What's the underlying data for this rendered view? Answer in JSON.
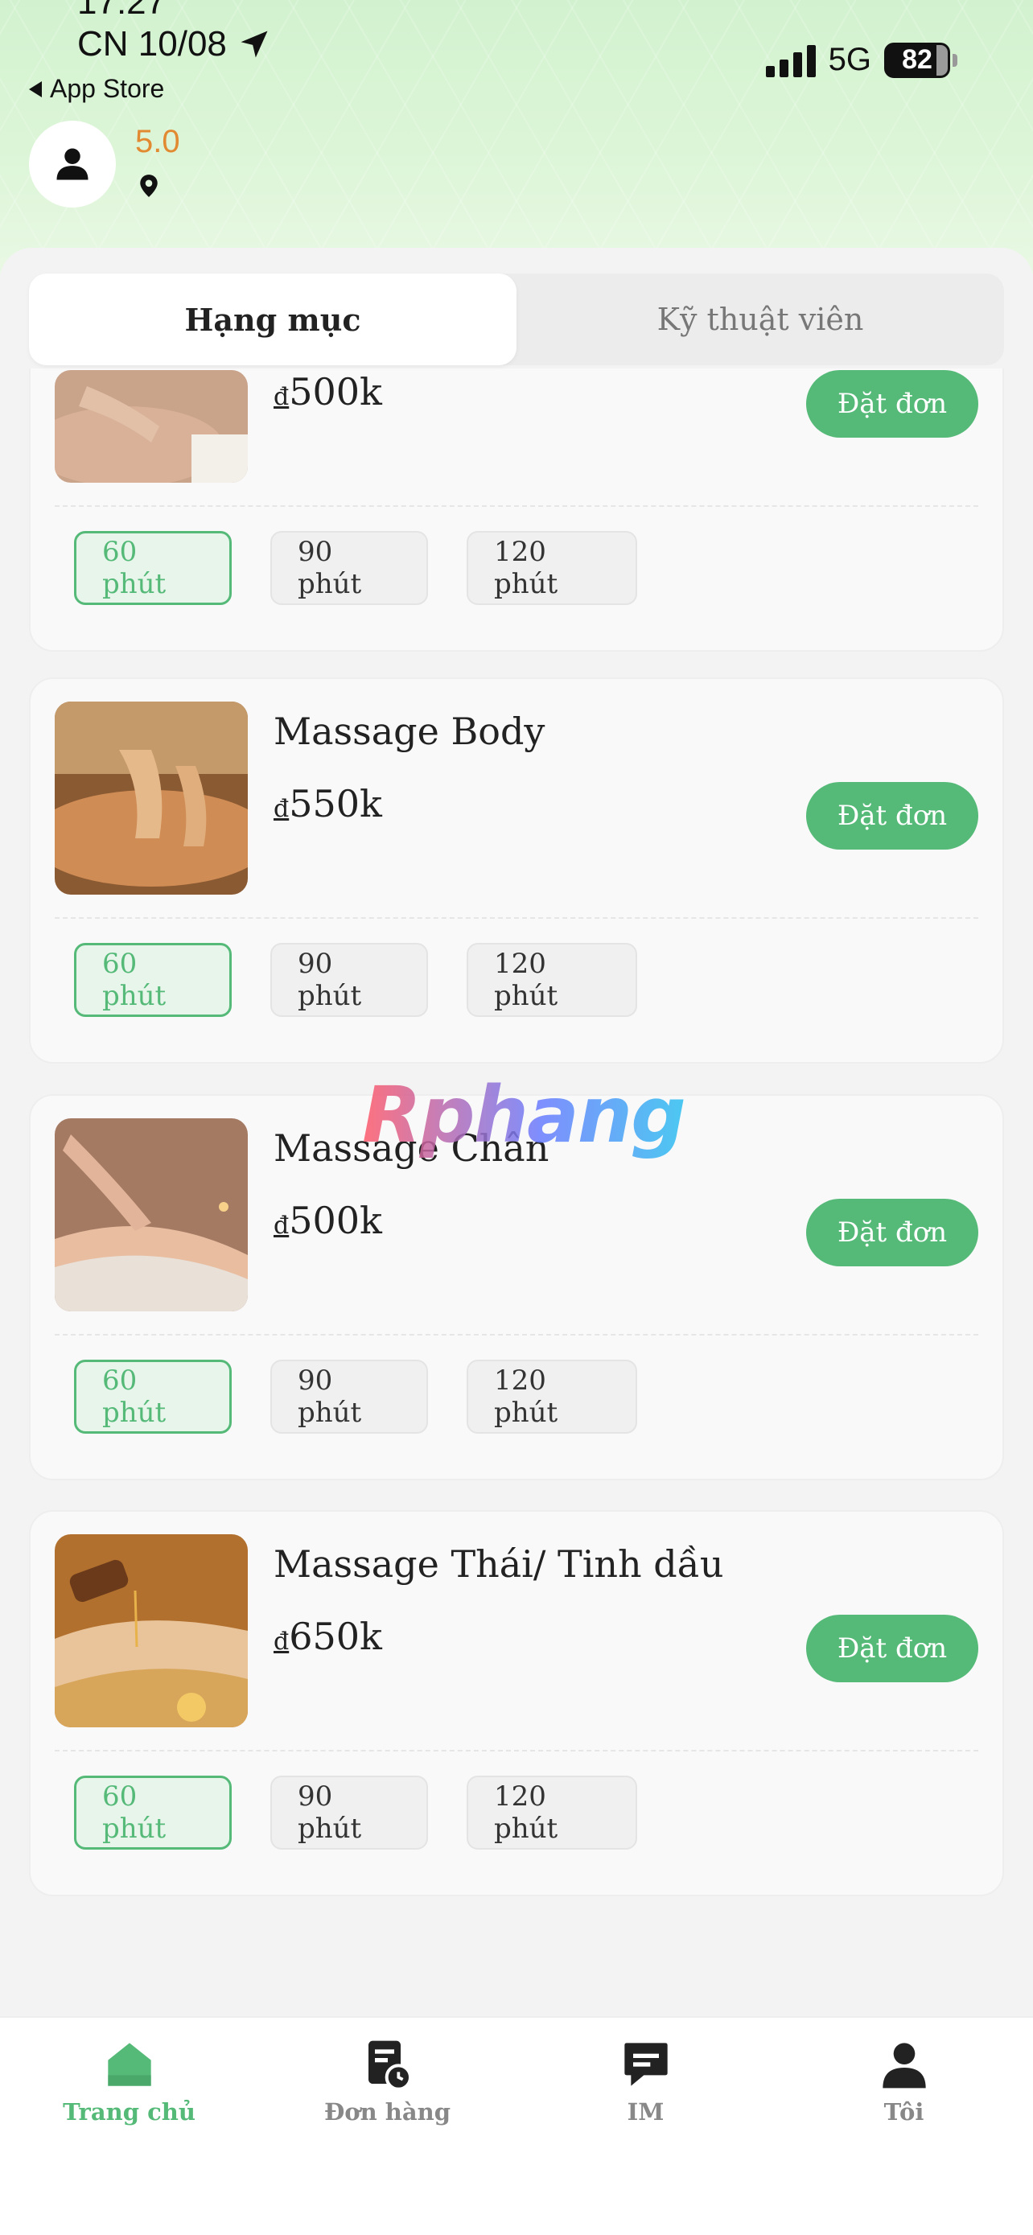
{
  "status_bar": {
    "time": "17:27",
    "date": "CN 10/08",
    "back_app": "App Store",
    "network": "5G",
    "battery": "82"
  },
  "profile": {
    "rating": "5.0"
  },
  "tabs": [
    {
      "label": "Hạng mục",
      "active": true
    },
    {
      "label": "Kỹ thuật viên",
      "active": false
    }
  ],
  "services": [
    {
      "name": "",
      "currency": "đ",
      "price": "500k",
      "book_label": "Đặt đơn",
      "durations": [
        "60 phút",
        "90 phút",
        "120 phút"
      ],
      "selected": "60 phút"
    },
    {
      "name": "Massage Body",
      "currency": "đ",
      "price": "550k",
      "book_label": "Đặt đơn",
      "durations": [
        "60 phút",
        "90 phút",
        "120 phút"
      ],
      "selected": "60 phút"
    },
    {
      "name": "Massage Chân",
      "currency": "đ",
      "price": "500k",
      "book_label": "Đặt đơn",
      "durations": [
        "60 phút",
        "90 phút",
        "120 phút"
      ],
      "selected": "60 phút"
    },
    {
      "name": "Massage Thái/ Tinh dầu",
      "currency": "đ",
      "price": "650k",
      "book_label": "Đặt đơn",
      "durations": [
        "60 phút",
        "90 phút",
        "120 phút"
      ],
      "selected": "60 phút"
    }
  ],
  "watermark": "Rphang",
  "bottom_nav": [
    {
      "label": "Trang chủ",
      "icon": "home-icon",
      "active": true
    },
    {
      "label": "Đơn hàng",
      "icon": "orders-icon",
      "active": false
    },
    {
      "label": "IM",
      "icon": "chat-icon",
      "active": false
    },
    {
      "label": "Tôi",
      "icon": "person-icon",
      "active": false
    }
  ],
  "colors": {
    "accent": "#55b978",
    "rating": "#e28a32",
    "header_bg": "#d2f2cf"
  }
}
